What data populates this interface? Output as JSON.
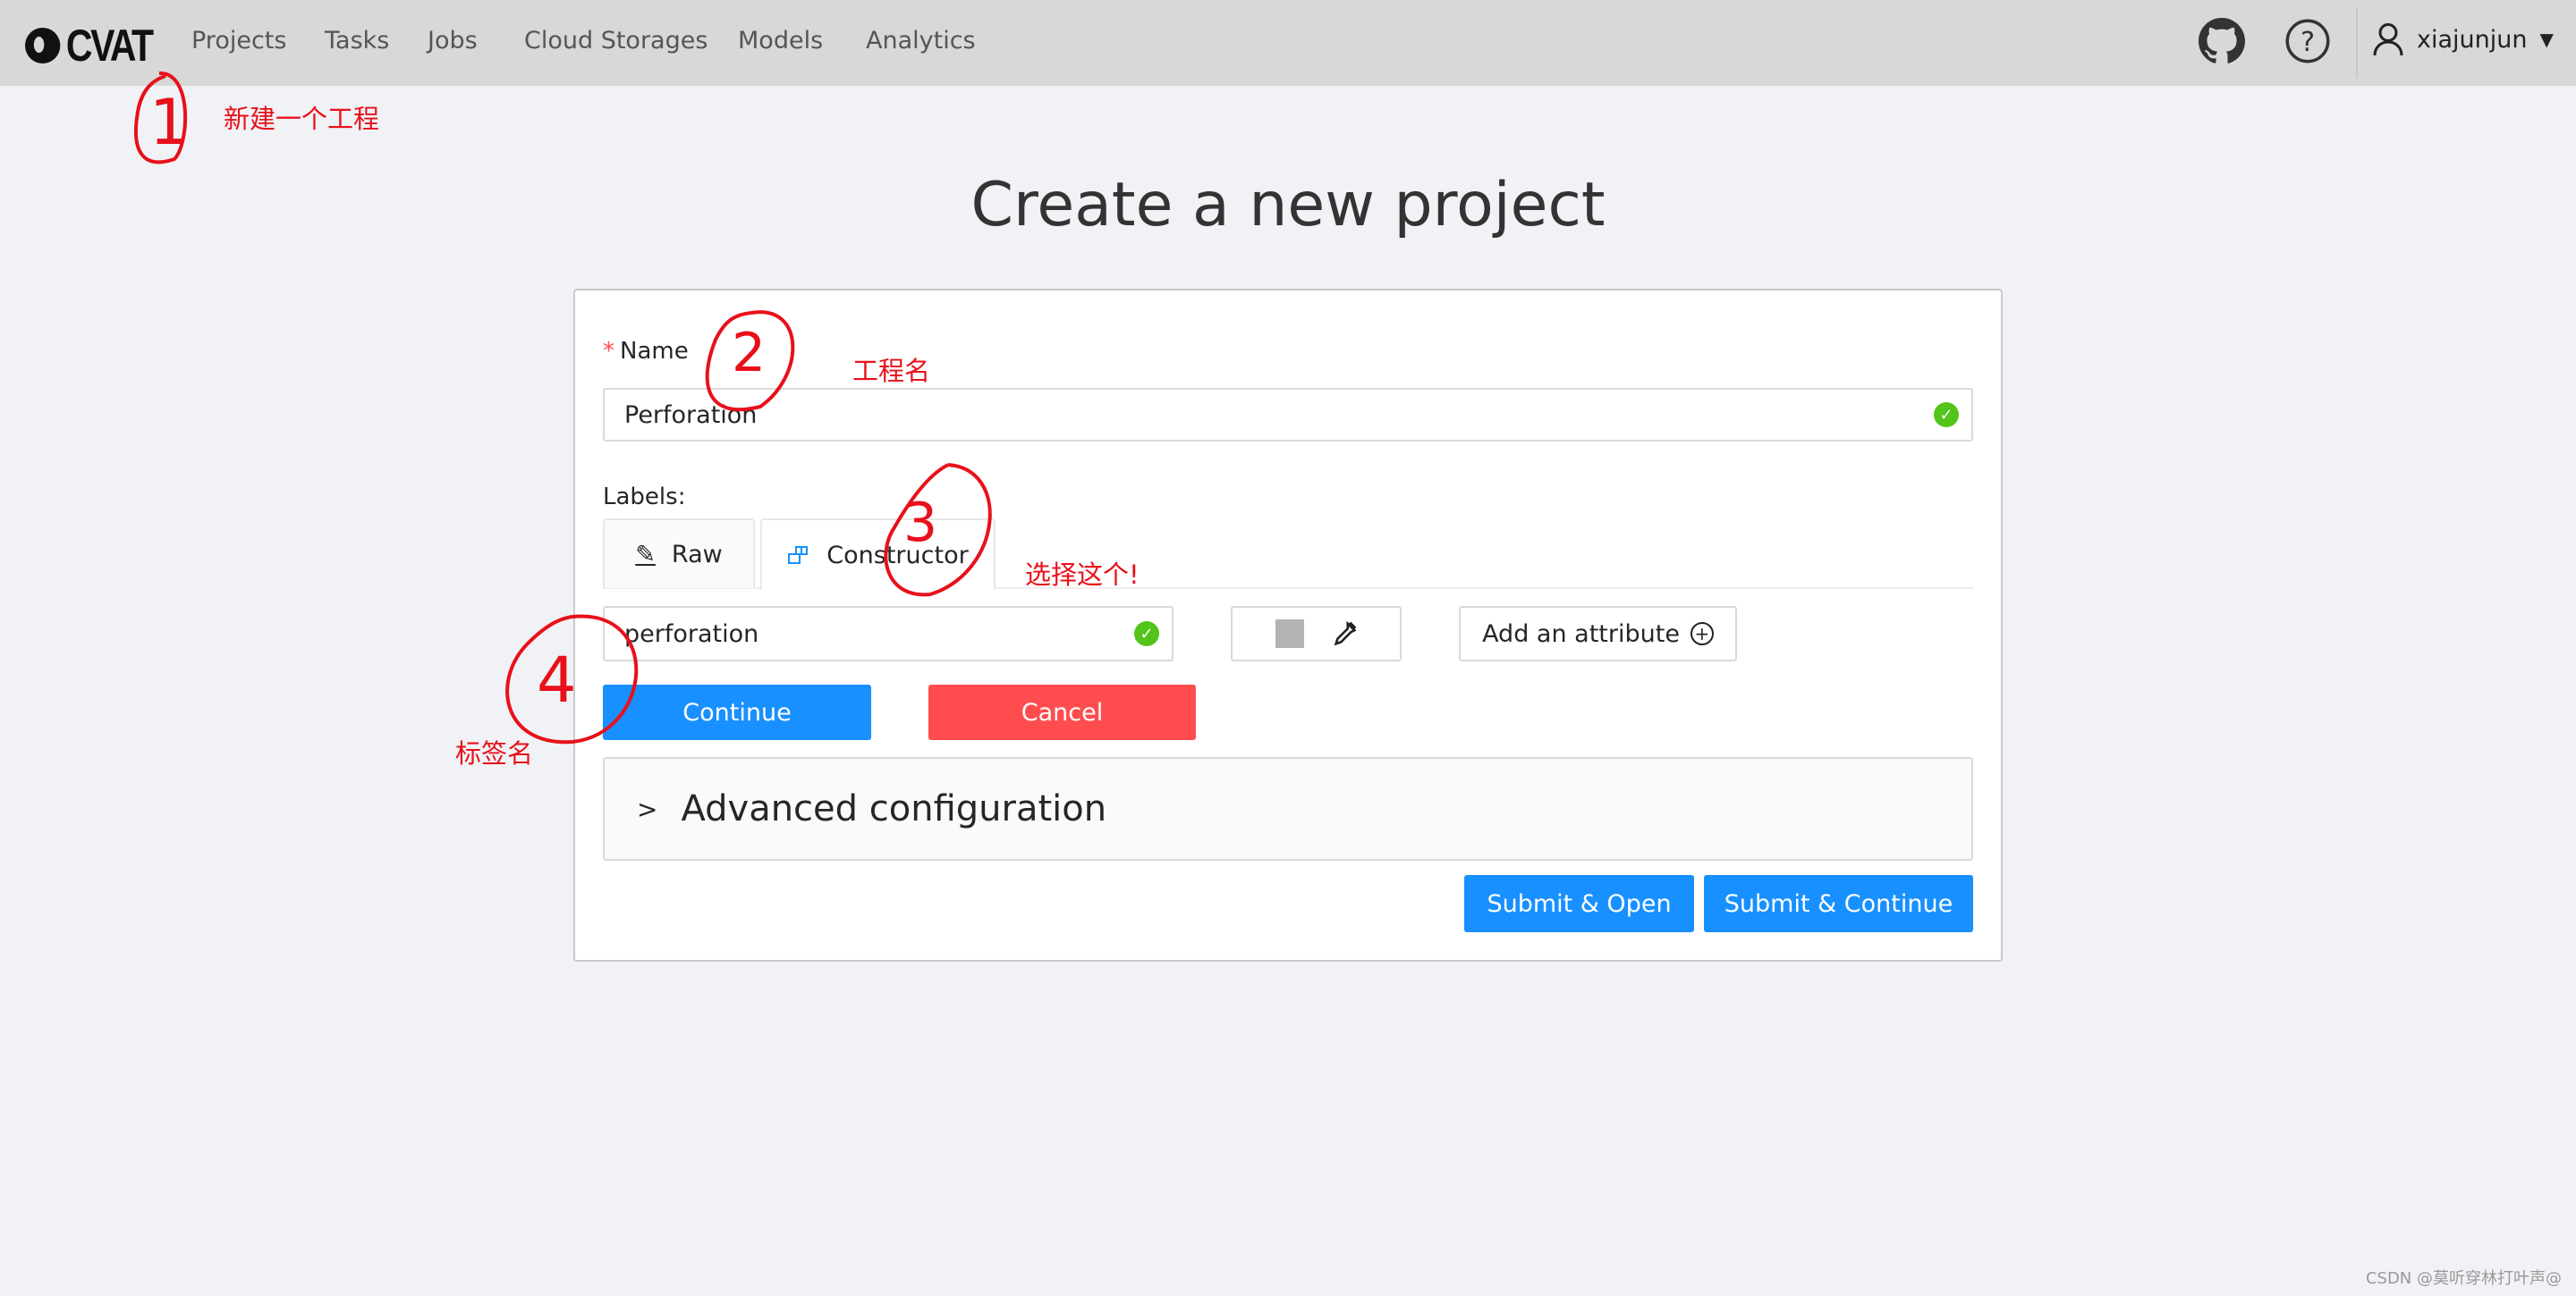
{
  "header": {
    "logo": "CVAT",
    "nav": [
      "Projects",
      "Tasks",
      "Jobs",
      "Cloud Storages",
      "Models",
      "Analytics"
    ],
    "icons": [
      "github-icon",
      "help-icon",
      "user-icon"
    ],
    "username": "xiajunjun"
  },
  "page": {
    "title": "Create a new project",
    "name_label": "Name",
    "required_mark": "*",
    "name_value": "Perforation",
    "labels_label": "Labels:",
    "tabs": [
      {
        "label": "Raw",
        "icon": "pencil-icon"
      },
      {
        "label": "Constructor",
        "icon": "constructor-icon",
        "active": true
      }
    ],
    "label_name_value": "perforation",
    "label_color": "#b3b3b3",
    "add_attribute": "Add an attribute",
    "continue": "Continue",
    "cancel": "Cancel",
    "advanced": "Advanced configuration",
    "submit_open": "Submit & Open",
    "submit_continue": "Submit & Continue"
  },
  "annotations": {
    "a1_number": "1",
    "a1_text": "新建一个工程",
    "a2_number": "2",
    "a2_text": "工程名",
    "a3_number": "3",
    "a3_text": "选择这个!",
    "a4_number": "4",
    "a4_text": "标签名"
  },
  "watermark": "CSDN @莫听穿林打叶声@",
  "colors": {
    "primary": "#1890ff",
    "danger": "#ff4d4f",
    "success": "#52c41a",
    "annotation": "#e8101a",
    "header_bg": "#d8d8d8",
    "page_bg": "#f0f2f5"
  }
}
